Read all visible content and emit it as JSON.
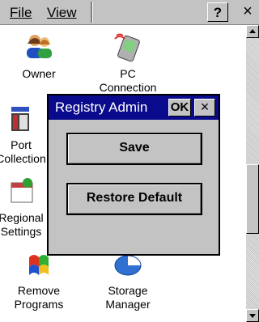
{
  "menubar": {
    "file_label": "File",
    "view_label": "View",
    "help_label": "?",
    "close_label": "×"
  },
  "desktop": {
    "icons": [
      {
        "label": "Owner",
        "icon": "owner-icon"
      },
      {
        "label": "PC\nConnection",
        "icon": "pc-connection-icon"
      },
      {
        "label": "Port\nCollection",
        "icon": "port-collection-icon"
      },
      {
        "label": "Regional\nSettings",
        "icon": "regional-settings-icon"
      },
      {
        "label": "Remove\nPrograms",
        "icon": "remove-programs-icon"
      },
      {
        "label": "Storage\nManager",
        "icon": "storage-manager-icon"
      }
    ]
  },
  "dialog": {
    "title": "Registry Admin",
    "ok_label": "OK",
    "close_label": "×",
    "save_label": "Save",
    "restore_label": "Restore Default"
  },
  "colors": {
    "titlebar": "#0a0a8c",
    "chrome": "#c3c3c3"
  }
}
